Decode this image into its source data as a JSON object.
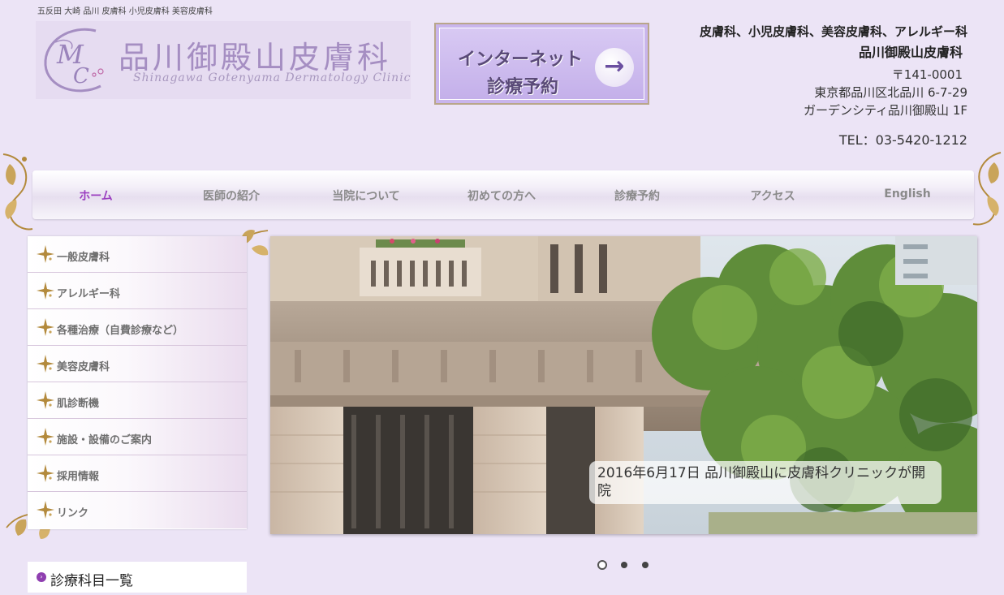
{
  "header": {
    "tagline": "五反田 大崎 品川 皮膚科 小児皮膚科 美容皮膚科",
    "logo": {
      "title": "品川御殿山皮膚科",
      "subtitle": "Shinagawa Gotenyama Dermatology Clinic",
      "monogram": "MC"
    },
    "reserve_button": {
      "line1": "インターネット",
      "line2": "診療予約",
      "arrow": "→"
    },
    "clinic_info": {
      "specialties": "皮膚科、小児皮膚科、美容皮膚科、アレルギー科",
      "name": "品川御殿山皮膚科",
      "postal": "〒141-0001",
      "address1": "東京都品川区北品川 6-7-29",
      "address2": "ガーデンシティ品川御殿山 1F",
      "tel": "TEL：03-5420-1212"
    }
  },
  "nav": {
    "items": [
      {
        "label": "ホーム",
        "active": true
      },
      {
        "label": "医師の紹介",
        "active": false
      },
      {
        "label": "当院について",
        "active": false
      },
      {
        "label": "初めての方へ",
        "active": false
      },
      {
        "label": "診療予約",
        "active": false
      },
      {
        "label": "アクセス",
        "active": false
      },
      {
        "label": "English",
        "active": false
      }
    ]
  },
  "sidebar": {
    "items": [
      {
        "label": "一般皮膚科",
        "icon": "sparkle-icon"
      },
      {
        "label": "アレルギー科",
        "icon": "sparkle-icon"
      },
      {
        "label": "各種治療（自費診療など）",
        "icon": "sparkle-icon"
      },
      {
        "label": "美容皮膚科",
        "icon": "sparkle-icon"
      },
      {
        "label": "肌診断機",
        "icon": "sparkle-icon"
      },
      {
        "label": "施設・設備のご案内",
        "icon": "sparkle-icon"
      },
      {
        "label": "採用情報",
        "icon": "sparkle-icon"
      },
      {
        "label": "リンク",
        "icon": "sparkle-icon"
      }
    ],
    "section_title": "診療科目一覧"
  },
  "slider": {
    "caption": "2016年6月17日 品川御殿山に皮膚科クリニックが開院",
    "slide_count": 3,
    "active_slide": 1
  },
  "colors": {
    "background": "#ece4f6",
    "accent": "#9b3fc0",
    "gold": "#b38a3c"
  }
}
